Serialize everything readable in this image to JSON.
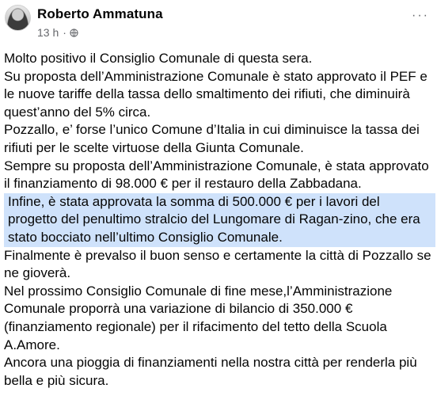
{
  "post": {
    "author": "Roberto Ammatuna",
    "time": "13 h",
    "separator": "·",
    "more_label": "···",
    "paragraphs": [
      "Molto positivo il Consiglio Comunale di questa sera.",
      "Su proposta dell’Amministrazione Comunale è stato approvato il PEF e le nuove tariffe della tassa dello smaltimento dei rifiuti, che diminuirà quest’anno del 5% circa.",
      "Pozzallo, e’ forse l’unico Comune d’Italia in cui diminuisce la tassa dei rifiuti per le scelte virtuose della Giunta Comunale.",
      "Sempre su proposta dell’Amministrazione Comunale, è stata approvato il finanziamento di 98.000 € per il restauro della Zabbadana.",
      "Infine, è stata approvata la somma di 500.000 € per i lavori del progetto del penultimo stralcio del Lungomare di Ragan-zino, che era stato bocciato nell’ultimo Consiglio Comunale.",
      "Finalmente è prevalso il buon senso e certamente la città di Pozzallo se ne gioverà.",
      "Nel prossimo Consiglio Comunale di fine mese,l’Amministrazione Comunale proporrà una variazione di bilancio di 350.000 € (finanziamento regionale) per il rifacimento del tetto della Scuola A.Amore.",
      "Ancora una pioggia di finanziamenti nella nostra città per renderla più bella e più sicura."
    ],
    "highlight_color": "#cfe2fb"
  }
}
